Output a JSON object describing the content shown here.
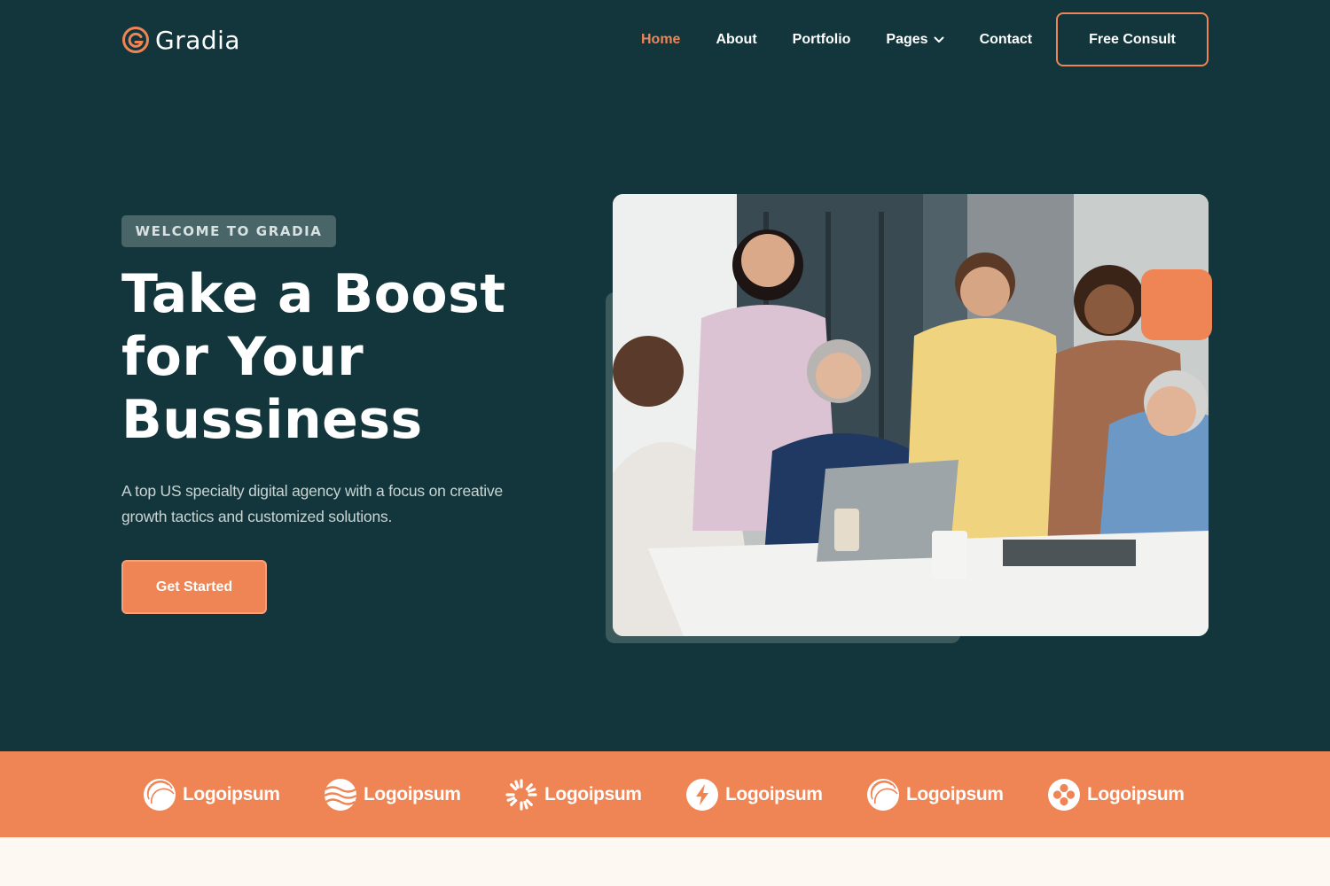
{
  "brand": {
    "name": "Gradia",
    "accent": "#ef8454",
    "background": "#12363c"
  },
  "nav": {
    "items": [
      {
        "label": "Home",
        "active": true
      },
      {
        "label": "About"
      },
      {
        "label": "Portfolio"
      },
      {
        "label": "Pages",
        "has_dropdown": true
      },
      {
        "label": "Contact"
      }
    ],
    "cta_label": "Free Consult"
  },
  "hero": {
    "badge": "WELCOME TO GRADIA",
    "title_lines": [
      "Take a Boost",
      "for Your",
      "Bussiness"
    ],
    "description": "A top US specialty digital agency with a focus on creative growth tactics and customized solutions.",
    "cta_label": "Get Started",
    "image_alt_icon": "team-photo"
  },
  "partners": [
    {
      "name": "Logoipsum",
      "icon": "sphere-icon"
    },
    {
      "name": "Logoipsum",
      "icon": "waves-icon"
    },
    {
      "name": "Logoipsum",
      "icon": "sunburst-icon"
    },
    {
      "name": "Logoipsum",
      "icon": "bolt-icon"
    },
    {
      "name": "Logoipsum",
      "icon": "sphere-icon"
    },
    {
      "name": "Logoipsum",
      "icon": "clover-icon"
    }
  ]
}
